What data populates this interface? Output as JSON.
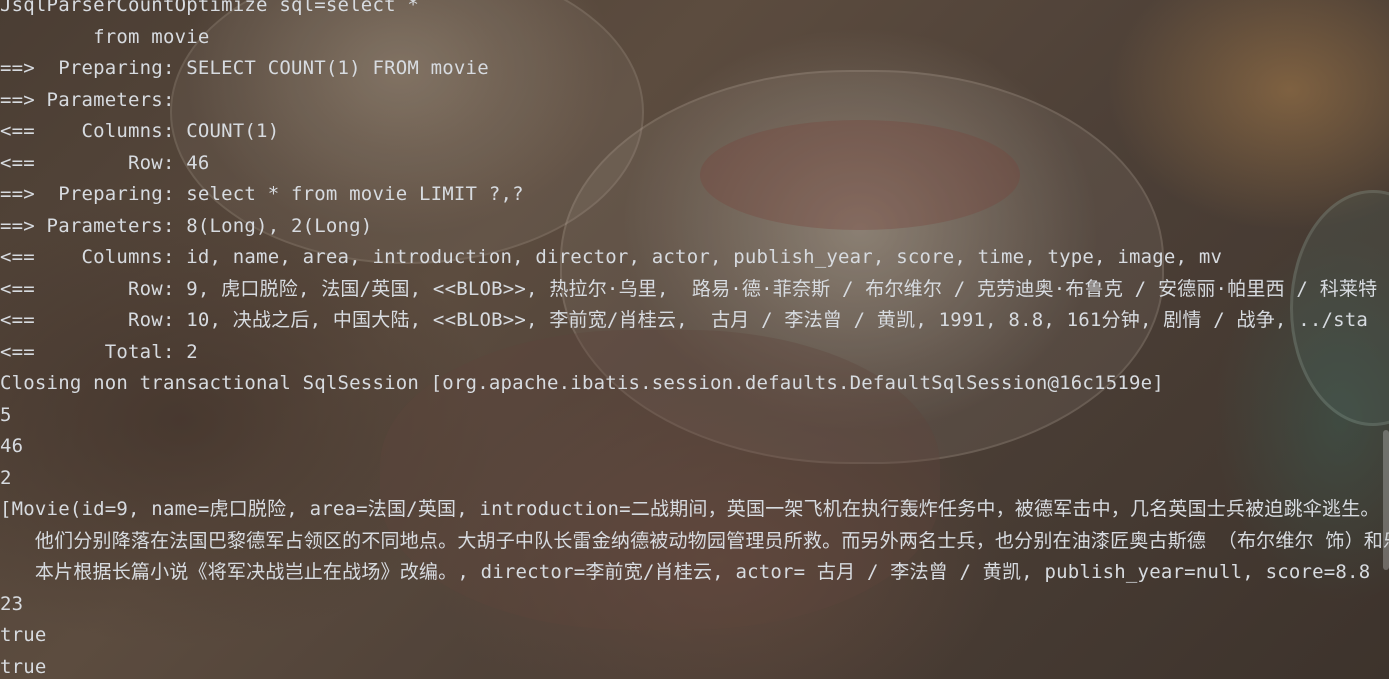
{
  "console": {
    "lines": [
      "JsqlParserCountOptimize sql=select *",
      "        from movie",
      "==>  Preparing: SELECT COUNT(1) FROM movie",
      "==> Parameters: ",
      "<==    Columns: COUNT(1)",
      "<==        Row: 46",
      "==>  Preparing: select * from movie LIMIT ?,?",
      "==> Parameters: 8(Long), 2(Long)",
      "<==    Columns: id, name, area, introduction, director, actor, publish_year, score, time, type, image, mv",
      "<==        Row: 9, 虎口脱险, 法国/英国, <<BLOB>>, 热拉尔·乌里,  路易·德·菲奈斯 / 布尔维尔 / 克劳迪奥·布鲁克 / 安德丽·帕里西 / 科莱特",
      "<==        Row: 10, 决战之后, 中国大陆, <<BLOB>>, 李前宽/肖桂云,  古月 / 李法曾 / 黄凯, 1991, 8.8, 161分钟, 剧情 / 战争, ../sta",
      "<==      Total: 2",
      "Closing non transactional SqlSession [org.apache.ibatis.session.defaults.DefaultSqlSession@16c1519e]",
      "5",
      "46",
      "2",
      "[Movie(id=9, name=虎口脱险, area=法国/英国, introduction=二战期间，英国一架飞机在执行轰炸任务中，被德军击中，几名英国士兵被迫跳伞逃生。",
      "   他们分别降落在法国巴黎德军占领区的不同地点。大胡子中队长雷金纳德被动物园管理员所救。而另外两名士兵，也分别在油漆匠奥古斯德 （布尔维尔 饰）和乐",
      "   本片根据长篇小说《将军决战岂止在战场》改编。, director=李前宽/肖桂云, actor= 古月 / 李法曾 / 黄凯, publish_year=null, score=8.8",
      "23",
      "true",
      "true"
    ]
  }
}
